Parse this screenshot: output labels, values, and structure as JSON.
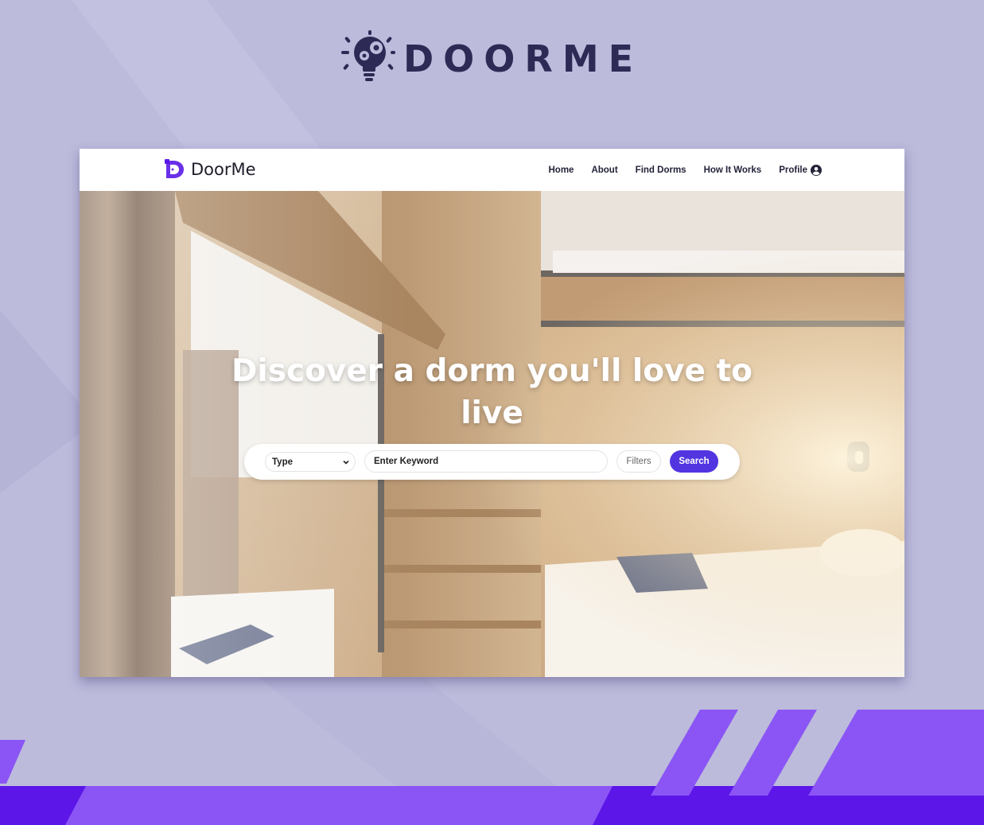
{
  "brand": {
    "name": "DOORME"
  },
  "navbar": {
    "logo_text": "DoorMe",
    "links": [
      "Home",
      "About",
      "Find Dorms",
      "How It Works",
      "Profile"
    ]
  },
  "hero": {
    "title": "Discover a dorm you'll love to live"
  },
  "search": {
    "type_label": "Type",
    "keyword_placeholder": "Enter Keyword",
    "filters_label": "Filters",
    "search_label": "Search"
  },
  "colors": {
    "background": "#bcbbdc",
    "brand_dark": "#2d2a55",
    "accent": "#5235e0",
    "stripe_purple": "#8b55f5",
    "stripe_deep": "#5c16e8"
  }
}
